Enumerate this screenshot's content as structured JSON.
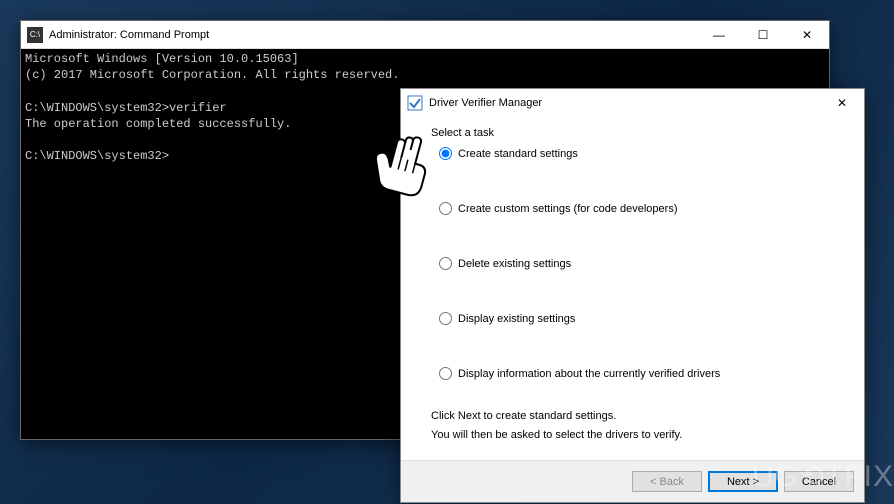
{
  "cmd": {
    "title": "Administrator: Command Prompt",
    "lines": "Microsoft Windows [Version 10.0.15063]\n(c) 2017 Microsoft Corporation. All rights reserved.\n\nC:\\WINDOWS\\system32>verifier\nThe operation completed successfully.\n\nC:\\WINDOWS\\system32>"
  },
  "verifier": {
    "title": "Driver Verifier Manager",
    "task_label": "Select a task",
    "options": {
      "standard": "Create standard settings",
      "custom": "Create custom settings (for code developers)",
      "delete": "Delete existing settings",
      "display": "Display existing settings",
      "info": "Display information about the currently verified drivers"
    },
    "hint1": "Click Next to create standard settings.",
    "hint2": "You will then be asked to select the drivers to verify.",
    "buttons": {
      "back": "< Back",
      "next": "Next >",
      "cancel": "Cancel"
    }
  },
  "watermark": "UG⟲TFIX",
  "win_controls": {
    "min": "—",
    "max": "☐",
    "close": "✕"
  }
}
